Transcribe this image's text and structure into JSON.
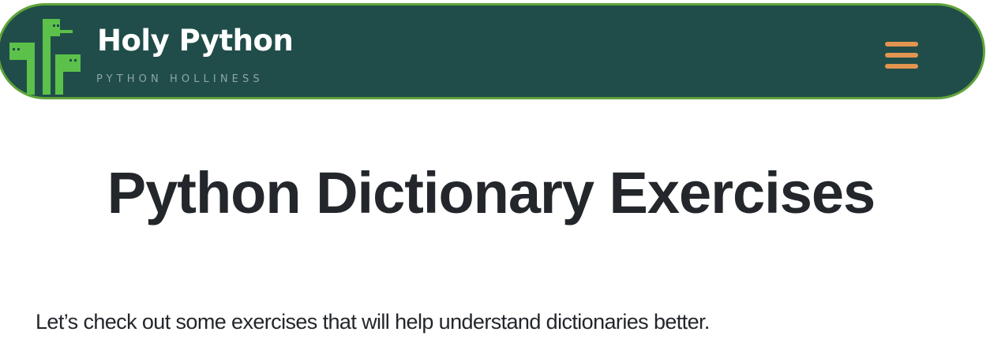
{
  "header": {
    "brand_title": "Holy Python",
    "brand_tagline": "PYTHON HOLLINESS",
    "logo_icon": "snake-logo-icon",
    "menu_icon": "hamburger-menu-icon"
  },
  "main": {
    "title": "Python Dictionary Exercises",
    "intro": "Let’s check out some exercises that will help understand dictionaries better."
  },
  "colors": {
    "navbar_background": "#204d49",
    "navbar_border": "#5fa33a",
    "logo_green": "#5cc14a",
    "menu_icon": "#e29450",
    "heading_text": "#23272b"
  }
}
